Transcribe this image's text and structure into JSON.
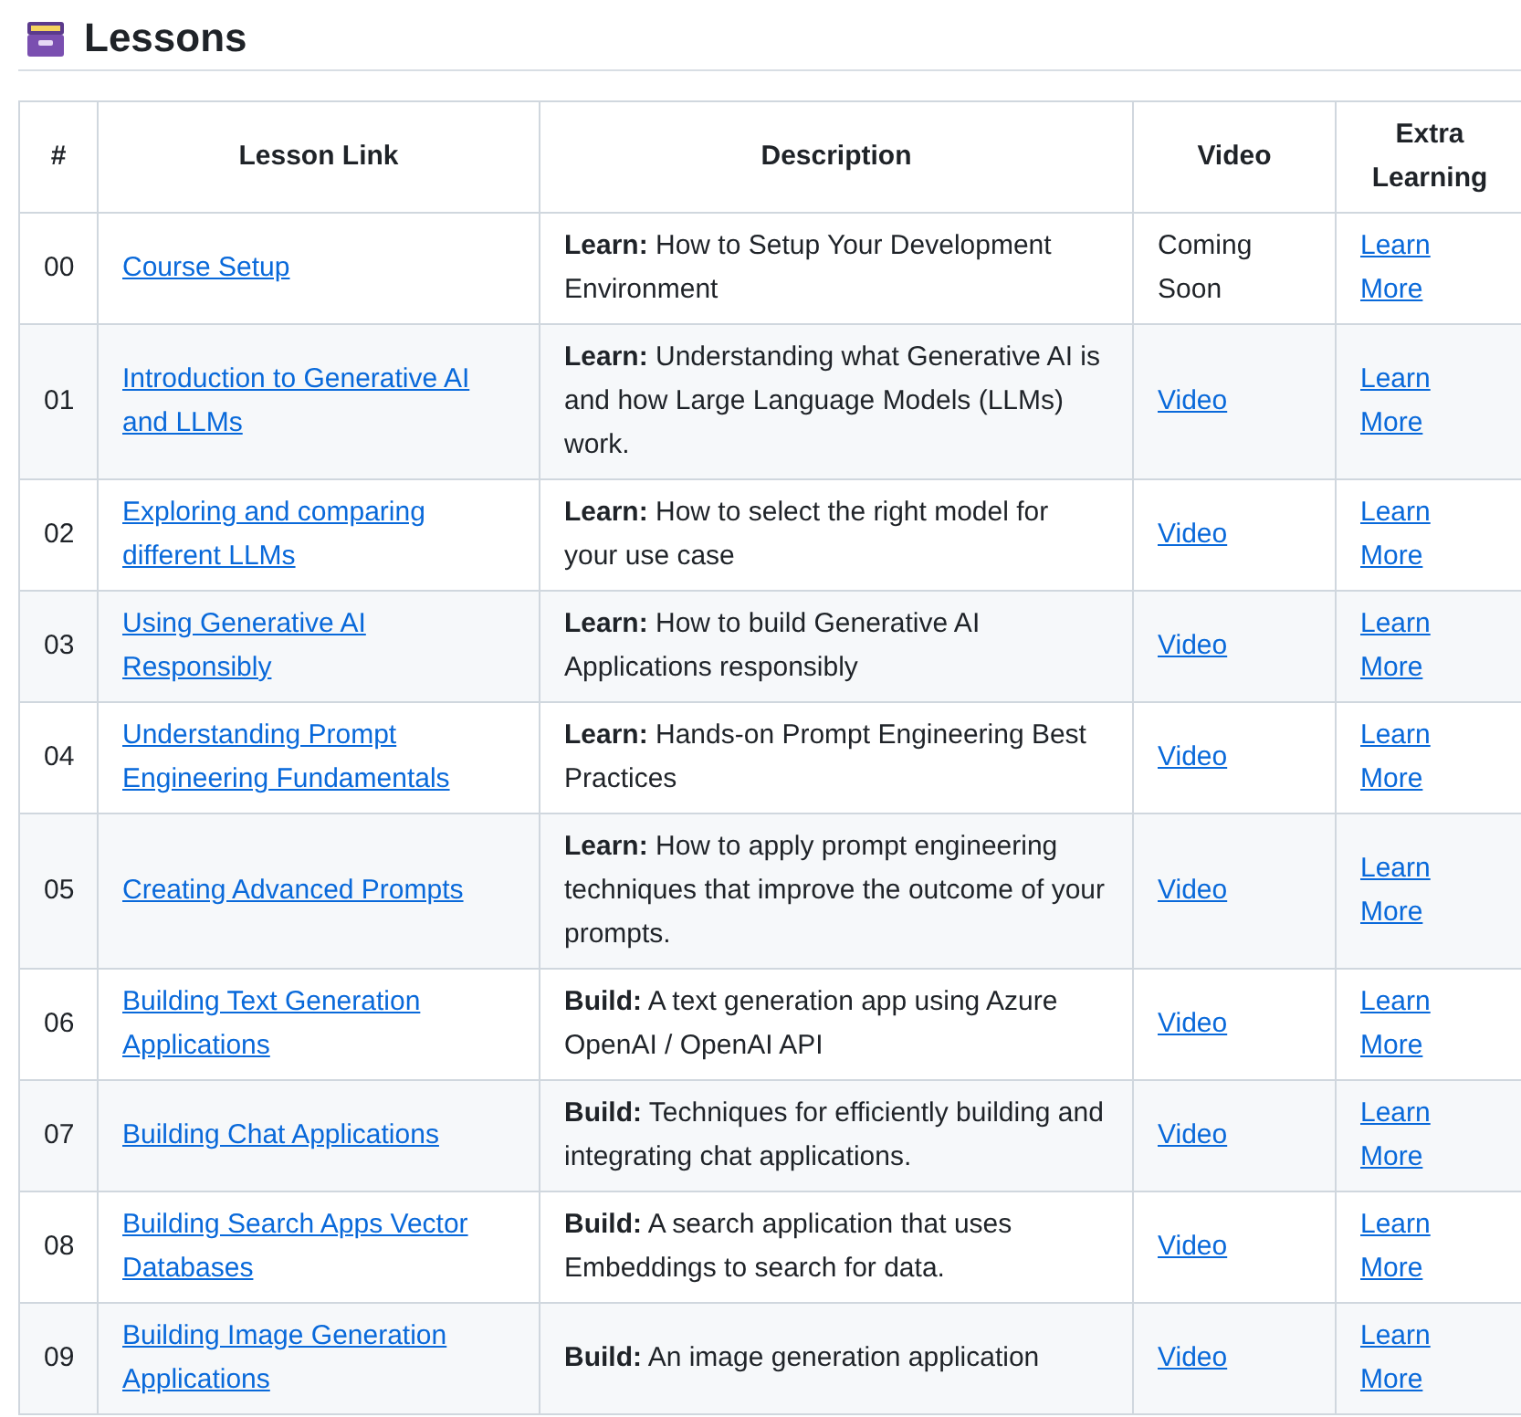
{
  "title": "Lessons",
  "table": {
    "columns": [
      "#",
      "Lesson Link",
      "Description",
      "Video",
      "Extra Learning"
    ],
    "rows": [
      {
        "number": "00",
        "lesson": "Course Setup",
        "description": "**Learn:** How to Setup Your Development Environment",
        "video": {
          "kind": "text",
          "text": "Coming Soon"
        },
        "extra": "Learn More"
      },
      {
        "number": "01",
        "lesson": "Introduction to Generative AI and LLMs",
        "description": "**Learn:** Understanding what Generative AI is and how Large Language Models (LLMs) work.",
        "video": {
          "kind": "link",
          "text": "Video"
        },
        "extra": "Learn More"
      },
      {
        "number": "02",
        "lesson": "Exploring and comparing different LLMs",
        "description": "**Learn:** How to select the right model for your use case",
        "video": {
          "kind": "link",
          "text": "Video"
        },
        "extra": "Learn More"
      },
      {
        "number": "03",
        "lesson": "Using Generative AI Responsibly",
        "description": "**Learn:** How to build Generative AI Applications responsibly",
        "video": {
          "kind": "link",
          "text": "Video"
        },
        "extra": "Learn More"
      },
      {
        "number": "04",
        "lesson": "Understanding Prompt Engineering Fundamentals",
        "description": "**Learn:** Hands-on Prompt Engineering Best Practices",
        "video": {
          "kind": "link",
          "text": "Video"
        },
        "extra": "Learn More"
      },
      {
        "number": "05",
        "lesson": "Creating Advanced Prompts",
        "description": "**Learn:** How to apply prompt engineering techniques that improve the outcome of your prompts.",
        "video": {
          "kind": "link",
          "text": "Video"
        },
        "extra": "Learn More"
      },
      {
        "number": "06",
        "lesson": "Building Text Generation Applications",
        "description": "**Build:** A text generation app using Azure OpenAI / OpenAI API",
        "video": {
          "kind": "link",
          "text": "Video"
        },
        "extra": "Learn More"
      },
      {
        "number": "07",
        "lesson": "Building Chat Applications",
        "description": "**Build:** Techniques for efficiently building and integrating chat applications.",
        "video": {
          "kind": "link",
          "text": "Video"
        },
        "extra": "Learn More"
      },
      {
        "number": "08",
        "lesson": "Building Search Apps Vector Databases",
        "description": "**Build:** A search application that uses Embeddings to search for data.",
        "video": {
          "kind": "link",
          "text": "Video"
        },
        "extra": "Learn More"
      },
      {
        "number": "09",
        "lesson": "Building Image Generation Applications",
        "description": "**Build:** An image generation application",
        "video": {
          "kind": "link",
          "text": "Video"
        },
        "extra": "Learn More"
      }
    ]
  }
}
